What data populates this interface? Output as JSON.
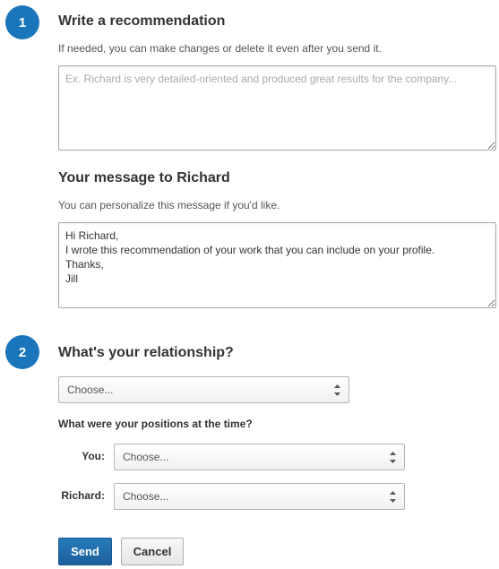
{
  "steps": [
    {
      "number": "1"
    },
    {
      "number": "2"
    }
  ],
  "recommendation": {
    "heading": "Write a recommendation",
    "helper": "If needed, you can make changes or delete it even after you send it.",
    "placeholder": "Ex. Richard is very detailed-oriented and produced great results for the company..."
  },
  "message": {
    "heading": "Your message to Richard",
    "helper": "You can personalize this message if you'd like.",
    "value": "Hi Richard,\nI wrote this recommendation of your work that you can include on your profile.\nThanks,\nJill"
  },
  "relationship": {
    "heading": "What's your relationship?",
    "select_value": "Choose..."
  },
  "positions": {
    "heading": "What were your positions at the time?",
    "you_label": "You:",
    "you_value": "Choose...",
    "richard_label": "Richard:",
    "richard_value": "Choose..."
  },
  "actions": {
    "send_label": "Send",
    "cancel_label": "Cancel"
  },
  "colors": {
    "accent": "#1b75bb"
  }
}
